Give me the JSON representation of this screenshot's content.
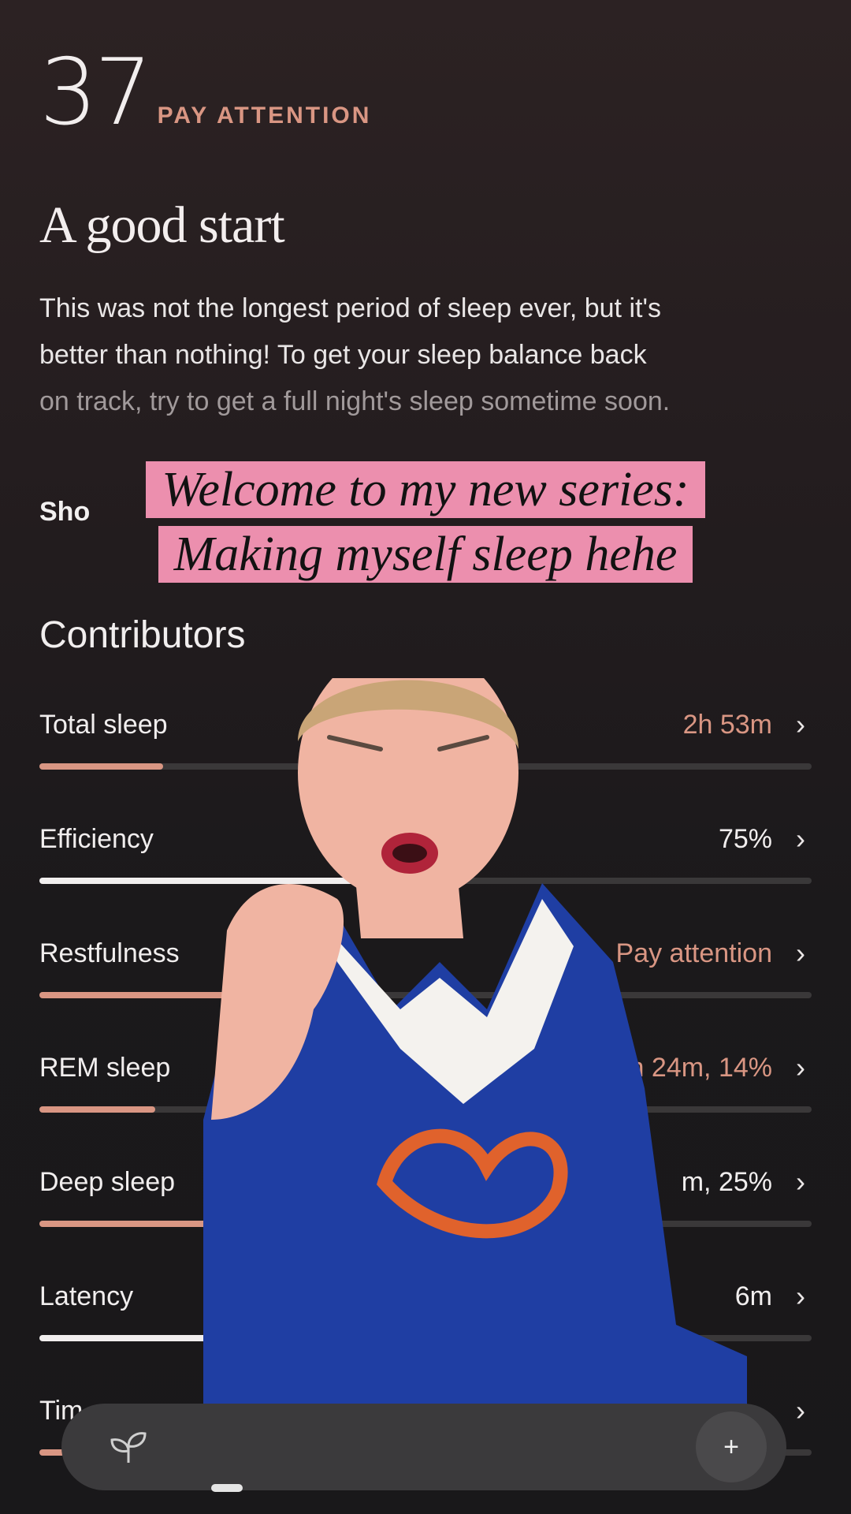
{
  "score": {
    "value": "37",
    "label": "PAY ATTENTION"
  },
  "headline": "A good start",
  "description": {
    "line1": "This was not the longest period of sleep ever, but it's",
    "line2": "better than nothing! To get your sleep balance back",
    "line3": "on track, try to get a full night's sleep sometime soon."
  },
  "show_more": "Sho",
  "caption": {
    "line1": "Welcome to my new series:",
    "line2": "Making myself sleep hehe"
  },
  "contributors": {
    "title": "Contributors",
    "items": [
      {
        "name": "Total sleep",
        "value": "2h 53m",
        "value_color": "#d99683",
        "level": 0.16,
        "bar_color": "#d99683"
      },
      {
        "name": "Efficiency",
        "value": "75%",
        "value_color": "#f1eeee",
        "level": 0.48,
        "bar_color": "#f1eeee"
      },
      {
        "name": "Restfulness",
        "value": "Pay attention",
        "value_color": "#d99683",
        "level": 0.44,
        "bar_color": "#d99683"
      },
      {
        "name": "REM sleep",
        "value": "0h 24m, 14%",
        "value_color": "#d99683",
        "level": 0.15,
        "bar_color": "#d99683"
      },
      {
        "name": "Deep sleep",
        "value": "m, 25%",
        "value_color": "#f1eeee",
        "level": 0.25,
        "bar_color": "#d99683"
      },
      {
        "name": "Latency",
        "value": "6m",
        "value_color": "#f1eeee",
        "level": 0.3,
        "bar_color": "#f1eeee"
      },
      {
        "name": "Tim",
        "value": "",
        "value_color": "#f1eeee",
        "level": 0.05,
        "bar_color": "#d99683"
      }
    ]
  },
  "nav": {
    "add_icon": "sparkle-plus-icon",
    "home_icon": "sprout-icon",
    "add_symbol": "+"
  },
  "colors": {
    "accent": "#d99683",
    "caption_bg": "#ec8fae",
    "jersey": "#1f3ea3",
    "skin": "#f0b4a2"
  }
}
